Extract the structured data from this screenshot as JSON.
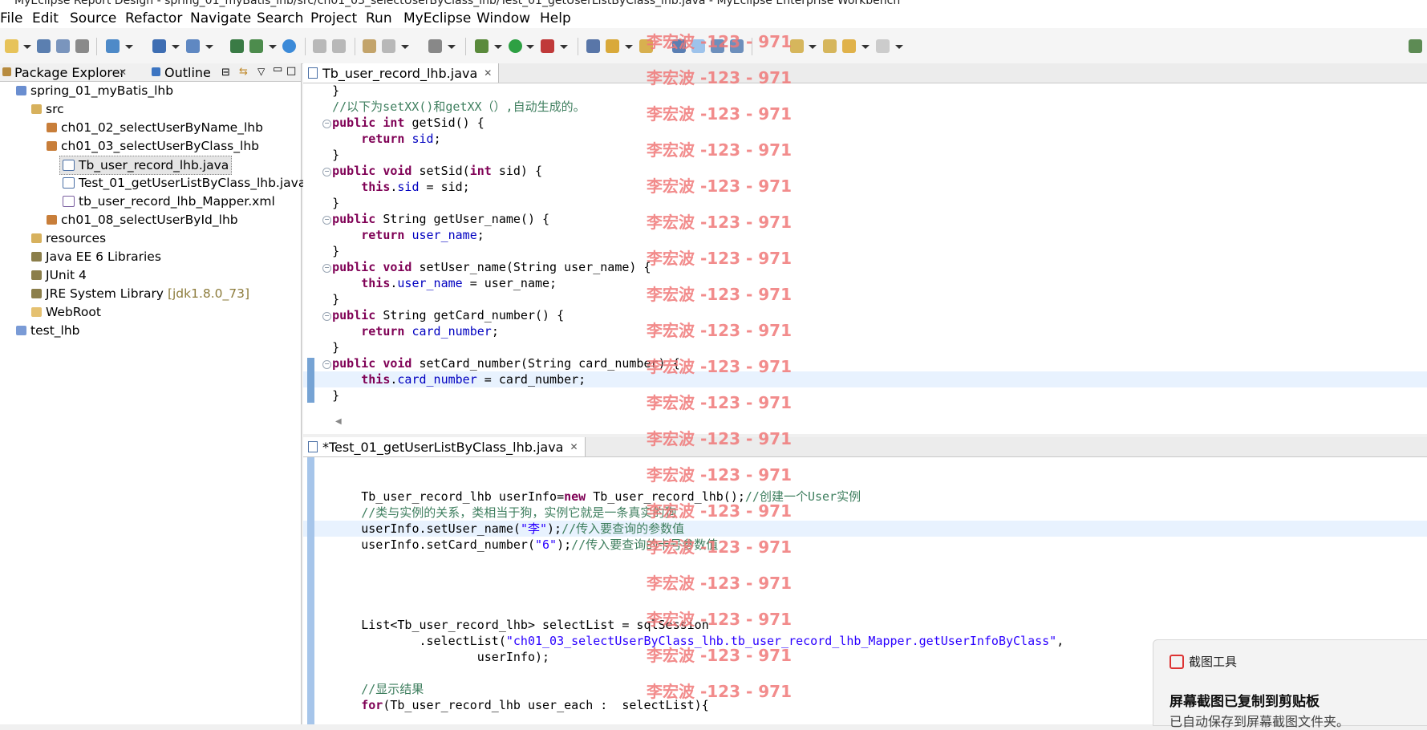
{
  "window": {
    "title": "MyEclipse Report Design - spring_01_myBatis_lhb/src/ch01_03_selectUserByClass_lhb/Test_01_getUserListByClass_lhb.java - MyEclipse Enterprise Workbench"
  },
  "menu": [
    "File",
    "Edit",
    "Source",
    "Refactor",
    "Navigate",
    "Search",
    "Project",
    "Run",
    "MyEclipse",
    "Window",
    "Help"
  ],
  "left_panel": {
    "tabs": [
      "Package Explorer",
      "Outline"
    ],
    "tree": [
      {
        "label": "spring_01_myBatis_lhb",
        "icon": "project-icon"
      },
      {
        "label": "src",
        "icon": "source-folder-icon"
      },
      {
        "label": "ch01_02_selectUserByName_lhb",
        "icon": "package-icon"
      },
      {
        "label": "ch01_03_selectUserByClass_lhb",
        "icon": "package-icon"
      },
      {
        "label": "Tb_user_record_lhb.java",
        "icon": "java-file-icon",
        "selected": true
      },
      {
        "label": "Test_01_getUserListByClass_lhb.java",
        "icon": "java-file-icon"
      },
      {
        "label": "tb_user_record_lhb_Mapper.xml",
        "icon": "xml-file-icon"
      },
      {
        "label": "ch01_08_selectUserById_lhb",
        "icon": "package-icon"
      },
      {
        "label": "resources",
        "icon": "source-folder-icon"
      },
      {
        "label": "Java EE 6 Libraries",
        "icon": "library-icon"
      },
      {
        "label": "JUnit 4",
        "icon": "library-icon"
      },
      {
        "label": "JRE System Library",
        "suffix": "[jdk1.8.0_73]",
        "icon": "library-icon"
      },
      {
        "label": "WebRoot",
        "icon": "folder-icon"
      },
      {
        "label": "test_lhb",
        "icon": "project-icon"
      }
    ]
  },
  "editor1": {
    "tab": "Tb_user_record_lhb.java",
    "lines": [
      "    }",
      "    //以下为setXX()和getXX（）,自动生成的。",
      "    public int getSid() {",
      "        return sid;",
      "    }",
      "    public void setSid(int sid) {",
      "        this.sid = sid;",
      "    }",
      "    public String getUser_name() {",
      "        return user_name;",
      "    }",
      "    public void setUser_name(String user_name) {",
      "        this.user_name = user_name;",
      "    }",
      "    public String getCard_number() {",
      "        return card_number;",
      "    }",
      "    public void setCard_number(String card_number) {",
      "        this.card_number = card_number;",
      "    }"
    ]
  },
  "editor2": {
    "tab": "*Test_01_getUserListByClass_lhb.java",
    "lines": [
      "",
      "",
      "        Tb_user_record_lhb userInfo=new Tb_user_record_lhb();//创建一个User实例",
      "        //类与实例的关系，类相当于狗，实例它就是一条真实的狗",
      "        userInfo.setUser_name(\"李\");//传入要查询的参数值",
      "        userInfo.setCard_number(\"6\");//传入要查询的卡号参数值",
      "",
      "",
      "",
      "",
      "        List<Tb_user_record_lhb> selectList = sqlSession",
      "                .selectList(\"ch01_03_selectUserByClass_lhb.tb_user_record_lhb_Mapper.getUserInfoByClass\",",
      "                        userInfo);",
      "",
      "        //显示结果",
      "        for(Tb_user_record_lhb user_each :  selectList){"
    ]
  },
  "watermark": "李宏波 -123 - 971",
  "notification": {
    "app": "截图工具",
    "title": "屏幕截图已复制到剪贴板",
    "body": "已自动保存到屏幕截图文件夹。"
  }
}
